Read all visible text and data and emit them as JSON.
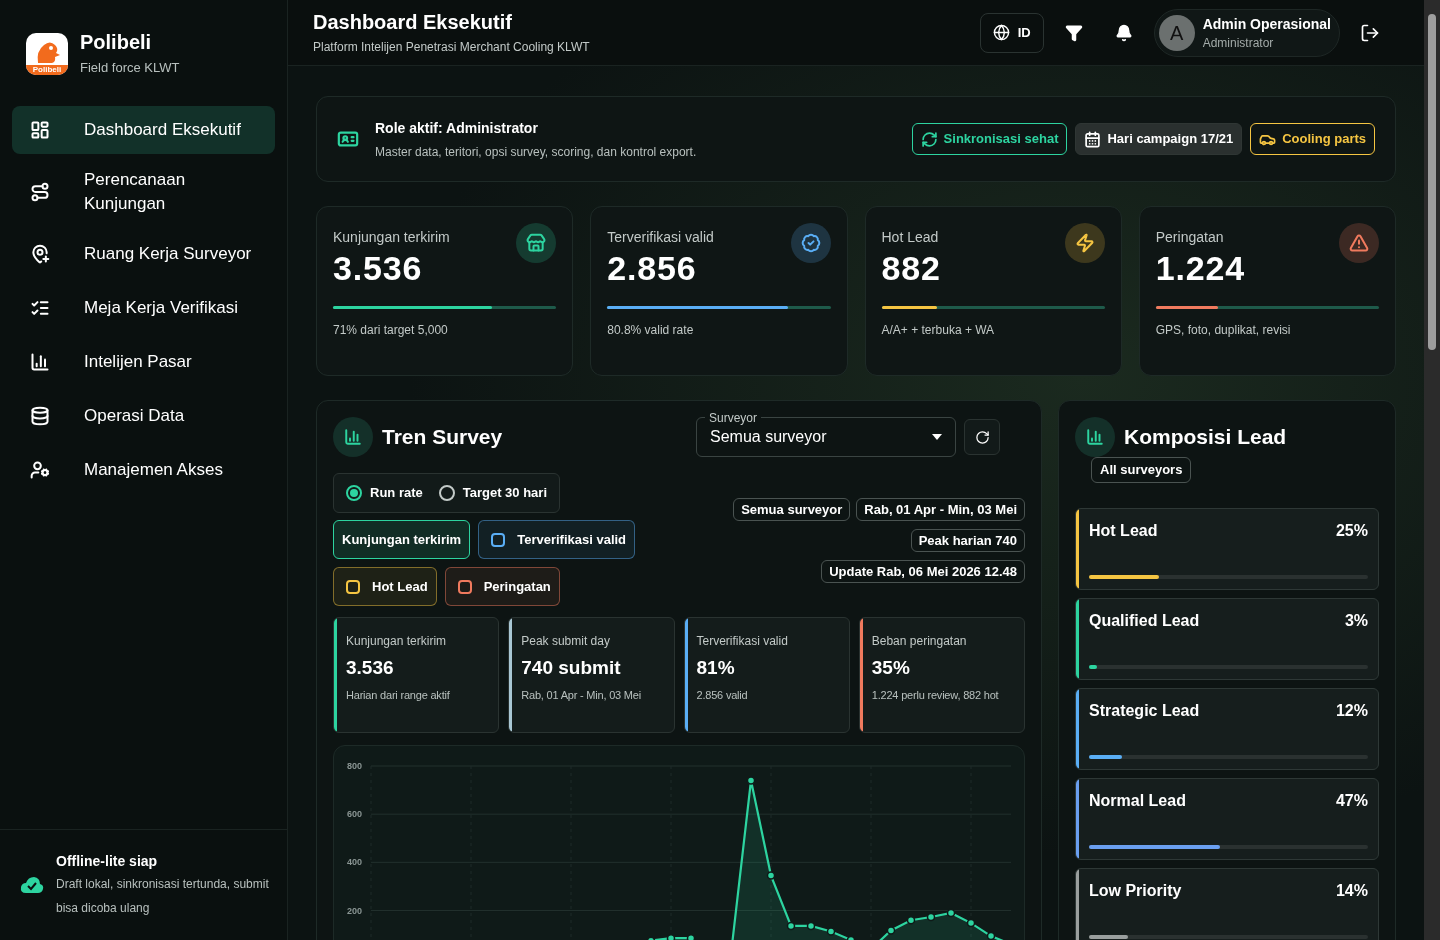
{
  "brand": {
    "name": "Polibeli",
    "subtitle": "Field force KLWT",
    "logo_text": "Polibeli"
  },
  "sidebar": {
    "items": [
      {
        "label": "Dashboard Eksekutif",
        "selected": true
      },
      {
        "label": "Perencanaan Kunjungan",
        "selected": false
      },
      {
        "label": "Ruang Kerja Surveyor",
        "selected": false
      },
      {
        "label": "Meja Kerja Verifikasi",
        "selected": false
      },
      {
        "label": "Intelijen Pasar",
        "selected": false
      },
      {
        "label": "Operasi Data",
        "selected": false
      },
      {
        "label": "Manajemen Akses",
        "selected": false
      }
    ],
    "footer": {
      "title": "Offline-lite siap",
      "text": "Draft lokal, sinkronisasi tertunda, submit bisa dicoba ulang"
    }
  },
  "header": {
    "title": "Dashboard Eksekutif",
    "subtitle": "Platform Intelijen Penetrasi Merchant Cooling KLWT",
    "language": "ID",
    "user": {
      "avatar": "A",
      "name": "Admin Operasional",
      "role": "Administrator"
    }
  },
  "role_card": {
    "title": "Role aktif: Administrator",
    "text": "Master data, teritori, opsi survey, scoring, dan kontrol export.",
    "badges": [
      {
        "label": "Sinkronisasi sehat",
        "kind": "sync"
      },
      {
        "label": "Hari campaign 17/21",
        "kind": "calendar"
      },
      {
        "label": "Cooling parts",
        "kind": "parts"
      }
    ]
  },
  "kpis": [
    {
      "label": "Kunjungan terkirim",
      "value": "3.536",
      "note": "71% dari target 5,000",
      "level": 0.71,
      "color": "#2dd4a0",
      "kind": "store"
    },
    {
      "label": "Terverifikasi valid",
      "value": "2.856",
      "note": "80.8% valid rate",
      "level": 0.81,
      "color": "#5aaef5",
      "kind": "verified"
    },
    {
      "label": "Hot Lead",
      "value": "882",
      "note": "A/A+ + terbuka + WA",
      "level": 0.25,
      "color": "#f5c542",
      "kind": "bolt"
    },
    {
      "label": "Peringatan",
      "value": "1.224",
      "note": "GPS, foto, duplikat, revisi",
      "level": 0.28,
      "color": "#f07a5e",
      "kind": "alert"
    }
  ],
  "trend": {
    "title": "Tren Survey",
    "surveyor": {
      "label": "Surveyor",
      "value": "Semua surveyor"
    },
    "modes": [
      {
        "label": "Run rate",
        "selected": true
      },
      {
        "label": "Target 30 hari",
        "selected": false
      }
    ],
    "series_toggles": [
      {
        "label": "Kunjungan terkirim",
        "checked": true,
        "color": "#2dd4a0"
      },
      {
        "label": "Terverifikasi valid",
        "checked": false,
        "color": "#5aaef5"
      },
      {
        "label": "Hot Lead",
        "checked": false,
        "color": "#f5c542"
      },
      {
        "label": "Peringatan",
        "checked": false,
        "color": "#f07a5e"
      }
    ],
    "chips": [
      "Semua surveyor",
      "Rab, 01 Apr - Min, 03 Mei",
      "Peak harian 740",
      "Update Rab, 06 Mei 2026 12.48"
    ],
    "stats": [
      {
        "label": "Kunjungan terkirim",
        "value": "3.536",
        "note": "Harian dari range aktif",
        "color": "#2dd4a0"
      },
      {
        "label": "Peak submit day",
        "value": "740 submit",
        "note": "Rab, 01 Apr - Min, 03 Mei",
        "color": "#a9c7d4"
      },
      {
        "label": "Terverifikasi valid",
        "value": "81%",
        "note": "2.856 valid",
        "color": "#5aaef5"
      },
      {
        "label": "Beban peringatan",
        "value": "35%",
        "note": "1.224 perlu review, 882 hot",
        "color": "#f07a5e"
      }
    ],
    "chart_data": {
      "type": "area",
      "ylim": [
        0,
        800
      ],
      "yticks": [
        200,
        400,
        600,
        800
      ],
      "grid": true,
      "series": [
        {
          "color": "#2dd4a0",
          "values": [
            0,
            0,
            0,
            0,
            0,
            0,
            0,
            0,
            0,
            0,
            0,
            0,
            0,
            40,
            75,
            85,
            85,
            20,
            20,
            740,
            345,
            136,
            136,
            113,
            78,
            40,
            117,
            160,
            173,
            190,
            148,
            94,
            60
          ]
        }
      ]
    }
  },
  "composition": {
    "title": "Komposisi Lead",
    "scope": "All surveyors",
    "items": [
      {
        "label": "Hot Lead",
        "percent": "25%",
        "level": 0.25,
        "color": "#f5c542"
      },
      {
        "label": "Qualified Lead",
        "percent": "3%",
        "level": 0.03,
        "color": "#2dd4a0"
      },
      {
        "label": "Strategic Lead",
        "percent": "12%",
        "level": 0.12,
        "color": "#5aaef5"
      },
      {
        "label": "Normal Lead",
        "percent": "47%",
        "level": 0.47,
        "color": "#6a9ff0"
      },
      {
        "label": "Low Priority",
        "percent": "14%",
        "level": 0.14,
        "color": "#9a9f9e"
      }
    ]
  }
}
